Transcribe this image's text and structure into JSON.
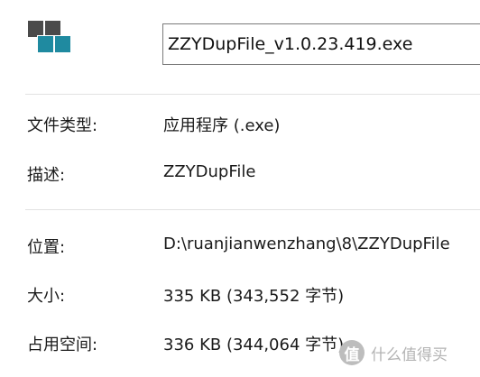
{
  "file": {
    "name": "ZZYDupFile_v1.0.23.419.exe",
    "icon": "app-icon-squares"
  },
  "properties": {
    "type_label": "文件类型:",
    "type_value": "应用程序 (.exe)",
    "description_label": "描述:",
    "description_value": "ZZYDupFile",
    "location_label": "位置:",
    "location_value": "D:\\ruanjianwenzhang\\8\\ZZYDupFile",
    "size_label": "大小:",
    "size_value": "335 KB (343,552 字节)",
    "disk_size_label": "占用空间:",
    "disk_size_value": "336 KB (344,064 字节)"
  },
  "watermark": {
    "logo_text": "值",
    "text": "什么值得买"
  },
  "colors": {
    "icon_gray": "#4a4a4a",
    "icon_teal": "#1f8aa0",
    "divider": "#e2e2e2"
  }
}
